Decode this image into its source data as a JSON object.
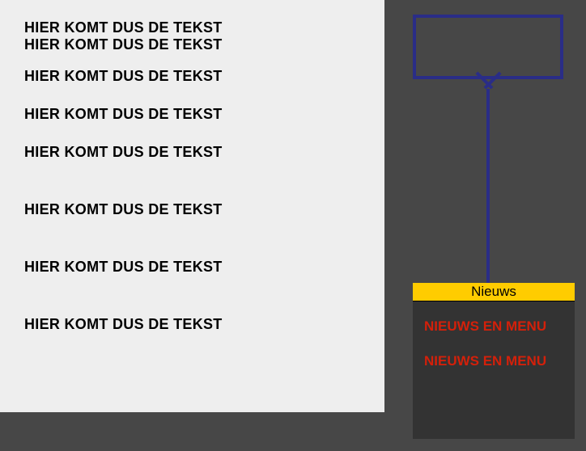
{
  "content": {
    "lines": [
      "HIER KOMT DUS DE TEKST",
      "HIER KOMT DUS DE TEKST",
      "HIER KOMT DUS DE TEKST",
      "HIER KOMT DUS DE TEKST",
      "HIER KOMT DUS DE TEKST",
      "HIER KOMT DUS DE TEKST",
      "HIER KOMT DUS DE TEKST",
      "HIER KOMT DUS DE TEKST"
    ]
  },
  "sidebar": {
    "header": "Nieuws",
    "items": [
      "NIEUWS EN MENU",
      "NIEUWS EN MENU"
    ]
  }
}
